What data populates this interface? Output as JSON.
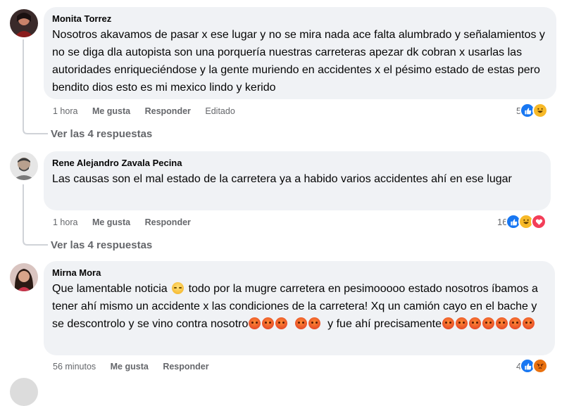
{
  "comments": [
    {
      "author": "Monita Torrez",
      "text": "Nosotros akavamos de pasar x ese lugar y no se mira nada ace falta alumbrado y señalamientos y no se diga dla autopista son una porquería nuestras carreteras apezar dk cobran x usarlas las autoridades enriqueciéndose y la gente muriendo en accidentes x el pésimo estado de estas pero bendito dios esto es mi mexico lindo y kerido",
      "time": "1 hora",
      "like_label": "Me gusta",
      "reply_label": "Responder",
      "edited_label": "Editado",
      "reaction_count": "5",
      "replies_label": "Ver las 4 respuestas",
      "reactions": [
        "like-icon",
        "haha-icon"
      ]
    },
    {
      "author": "Rene Alejandro Zavala Pecina",
      "text": "Las causas son el mal estado de la carretera ya a habido varios accidentes ahí en ese lugar",
      "time": "1 hora",
      "like_label": "Me gusta",
      "reply_label": "Responder",
      "reaction_count": "16",
      "replies_label": "Ver las 4 respuestas",
      "reactions": [
        "like-icon",
        "haha-icon",
        "love-icon"
      ]
    },
    {
      "author": "Mirna Mora",
      "text_part1": "Que lamentable noticia",
      "text_part2": "todo por la mugre carretera en pesimooooo estado nosotros íbamos a tener ahí mismo un accidente x las condiciones de la carretera! Xq un camión cayo en el bache y se descontrolo y se vino contra nosotro",
      "text_part3": "y fue ahí precisamente",
      "time": "56 minutos",
      "like_label": "Me gusta",
      "reply_label": "Responder",
      "reaction_count": "4",
      "reactions": [
        "like-icon",
        "angry-icon"
      ]
    }
  ],
  "colors": {
    "bubble": "#f0f2f5",
    "like_blue": "#1877f2",
    "love_red": "#f33e58",
    "haha_yellow": "#f7b928",
    "angry_orange": "#e9710f",
    "meta_gray": "#65676b"
  }
}
